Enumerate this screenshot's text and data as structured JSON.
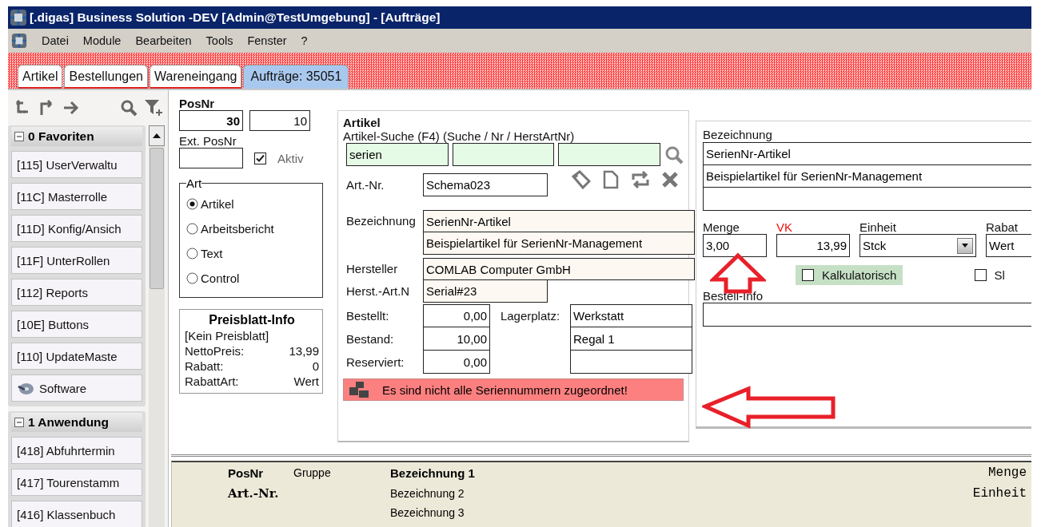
{
  "window": {
    "title": "[.digas] Business Solution -DEV [Admin@TestUmgebung] - [Aufträge]"
  },
  "menu": [
    {
      "label": "Datei"
    },
    {
      "label": "Module"
    },
    {
      "label": "Bearbeiten"
    },
    {
      "label": "Tools"
    },
    {
      "label": "Fenster"
    },
    {
      "label": "?"
    }
  ],
  "tabs": [
    {
      "label": "Artikel",
      "selected": false
    },
    {
      "label": "Bestellungen",
      "selected": false
    },
    {
      "label": "Wareneingang",
      "selected": false
    },
    {
      "label": "Aufträge: 35051",
      "selected": true
    }
  ],
  "sidebar": {
    "groups": [
      {
        "title": "0 Favoriten",
        "expanded": true,
        "items": [
          {
            "label": "[115] UserVerwaltu",
            "kind": "text"
          },
          {
            "label": "[11C] Masterrolle",
            "kind": "text"
          },
          {
            "label": "[11D] Konfig/Ansich",
            "kind": "text"
          },
          {
            "label": "[11F] UnterRollen",
            "kind": "text"
          },
          {
            "label": "[112] Reports",
            "kind": "text"
          },
          {
            "label": "[10E] Buttons",
            "kind": "text"
          },
          {
            "label": "[110] UpdateMaste",
            "kind": "text"
          },
          {
            "label": "Software",
            "kind": "icon"
          }
        ]
      },
      {
        "title": "1 Anwendung",
        "expanded": true,
        "items": [
          {
            "label": "[418] Abfuhrtermin",
            "kind": "text"
          },
          {
            "label": "[417] Tourenstamm",
            "kind": "text"
          },
          {
            "label": "[416] Klassenbuch",
            "kind": "text"
          }
        ]
      }
    ]
  },
  "position": {
    "label": "PosNr",
    "posnr": "30",
    "sub_posnr": "10",
    "ext_label": "Ext. PosNr",
    "active": {
      "label": "Aktiv",
      "checked": true
    }
  },
  "art": {
    "title": "Art",
    "options": [
      {
        "label": "Artikel",
        "selected": true
      },
      {
        "label": "Arbeitsbericht",
        "selected": false
      },
      {
        "label": "Text",
        "selected": false
      },
      {
        "label": "Control",
        "selected": false
      }
    ]
  },
  "price_info": {
    "title": "Preisblatt-Info",
    "note": "[Kein Preisblatt]",
    "rows": [
      {
        "label": "NettoPreis:",
        "value": "13,99"
      },
      {
        "label": "Rabatt:",
        "value": "0"
      },
      {
        "label": "RabattArt:",
        "value": "Wert"
      }
    ]
  },
  "article": {
    "title": "Artikel",
    "search_label": "Artikel-Suche (F4) (Suche / Nr / HerstArtNr)",
    "search_value": "serien",
    "art_nr": {
      "label": "Art.-Nr.",
      "value": "Schema023"
    },
    "designation": {
      "label": "Bezeichnung",
      "lines": [
        "SerienNr-Artikel",
        "Beispielartikel für SerienNr-Management"
      ]
    },
    "manufacturer": {
      "label": "Hersteller",
      "value": "COMLAB Computer GmbH"
    },
    "manufacturer_art_nr": {
      "label": "Herst.-Art.N",
      "value": "Serial#23"
    },
    "stock": [
      {
        "label": "Bestellt:",
        "value": "0,00"
      },
      {
        "label": "Bestand:",
        "value": "10,00"
      },
      {
        "label": "Reserviert:",
        "value": "0,00"
      }
    ],
    "storage": {
      "label": "Lagerplatz:",
      "lines": [
        "Werkstatt",
        "Regal 1"
      ]
    },
    "warning": "Es sind nicht alle Seriennummern zugeordnet!"
  },
  "position_detail": {
    "designation_label": "Bezeichnung",
    "designation_lines": [
      "SerienNr-Artikel",
      "Beispielartikel für SerienNr-Management"
    ],
    "quantity": {
      "label": "Menge",
      "value": "3,00"
    },
    "price": {
      "label": "VK",
      "value": "13,99"
    },
    "unit": {
      "label": "Einheit",
      "value": "Stck"
    },
    "discount": {
      "label": "Rabat",
      "value": "Wert"
    },
    "checkboxes": [
      {
        "label": "Kalkulatorisch",
        "checked": false
      },
      {
        "label": "Sl",
        "checked": false
      }
    ],
    "order_info_label": "Bestell-Info"
  },
  "list_header": {
    "posnr": "PosNr",
    "group": "Gruppe",
    "art_nr": "Art.-Nr.",
    "designations": [
      "Bezeichnung 1",
      "Bezeichnung 2",
      "Bezeichnung 3"
    ],
    "quantity": "Menge",
    "unit": "Einheit"
  },
  "annotations": [
    {
      "kind": "up"
    },
    {
      "kind": "left"
    }
  ]
}
